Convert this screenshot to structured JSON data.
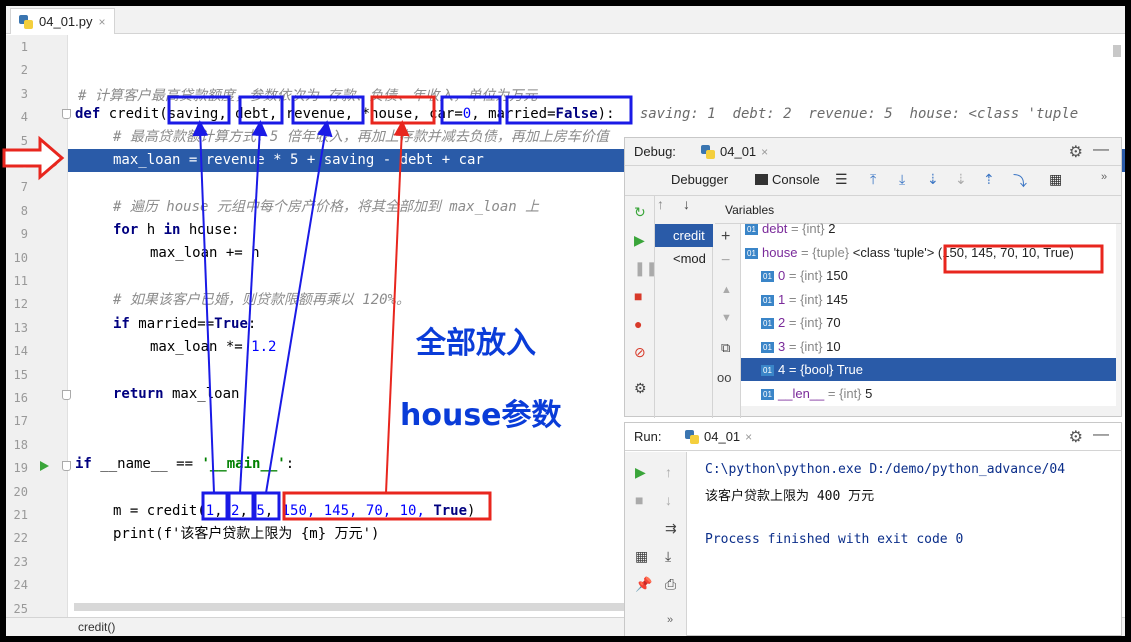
{
  "tab": {
    "filename": "04_01.py",
    "close": "×"
  },
  "gutter": {
    "lines": [
      "1",
      "2",
      "3",
      "4",
      "5",
      "6",
      "7",
      "8",
      "9",
      "10",
      "11",
      "12",
      "13",
      "14",
      "15",
      "16",
      "17",
      "18",
      "19",
      "20",
      "21",
      "22",
      "23",
      "24",
      "25"
    ]
  },
  "code": {
    "l3": "# 计算客户最高贷款额度，参数依次为 存款、负债、年收入，单位为万元",
    "l4_def": "def",
    "l4_name": " credit(",
    "l4_p1": "saving",
    "l4_p2": "debt",
    "l4_p3": "revenue",
    "l4_p4": "*house",
    "l4_p5a": "car=",
    "l4_p5b": "0",
    "l4_p6a": "married=",
    "l4_p6b": "False",
    "l4_end": "):",
    "l4_hint": "saving: 1  debt: 2  revenue: 5  house: <class 'tuple",
    "l5": "# 最高贷款额计算方式：5 倍年收入，再加上存款并减去负债，再加上房车价值",
    "l6": "max_loan = revenue * 5 + saving - debt + car",
    "l8": "# 遍历 house 元组中每个房产价格，将其全部加到 max_loan 上",
    "l9_kw1": "for",
    "l9_mid": " h ",
    "l9_kw2": "in",
    "l9_end": " house:",
    "l10": "max_loan += h",
    "l12": "# 如果该客户已婚，则贷款限额再乘以 120%。",
    "l13_kw": "if",
    "l13_mid": " married==",
    "l13_true": "True",
    "l13_end": ":",
    "l14a": "max_loan *= ",
    "l14b": "1.2",
    "l16_kw": "return",
    "l16_end": " max_loan",
    "l19_kw": "if",
    "l19_mid": " __name__ == ",
    "l19_str": "'__main__'",
    "l19_end": ":",
    "l21_a": "m = credit(",
    "l21_n1": "1",
    "l21_n2": "2",
    "l21_n3": "5",
    "l21_rest": "150, 145, 70, 10, ",
    "l21_true": "True",
    "l21_end": ")",
    "l22": "print(f'该客户贷款上限为 {m} 万元')"
  },
  "status_bar": "credit()",
  "debug": {
    "title": "Debug:",
    "tab": "04_01",
    "debugger_tab": "Debugger",
    "console_tab": "Console",
    "variables_header": "Variables",
    "frames": [
      "credit",
      "<mod"
    ],
    "vars": [
      {
        "name": "debt",
        "type": "= {int}",
        "value": "2"
      },
      {
        "name": "house",
        "type": "= {tuple}",
        "value": "<class 'tuple'> (150, 145, 70, 10, True)"
      },
      {
        "name": "0",
        "type": "= {int}",
        "value": "150"
      },
      {
        "name": "1",
        "type": "= {int}",
        "value": "145"
      },
      {
        "name": "2",
        "type": "= {int}",
        "value": "70"
      },
      {
        "name": "3",
        "type": "= {int}",
        "value": "10"
      },
      {
        "name": "4",
        "type": "= {bool}",
        "value": "True"
      },
      {
        "name": "__len__",
        "type": "= {int}",
        "value": "5"
      }
    ]
  },
  "run": {
    "title": "Run:",
    "tab": "04_01",
    "cmd": "C:\\python\\python.exe D:/demo/python_advance/04",
    "out1": "该客户贷款上限为 400 万元",
    "out2": "Process finished with exit code 0"
  },
  "annotations": {
    "line1": "全部放入",
    "line2": "house参数"
  },
  "colors": {
    "highlight": "#2a5ba8",
    "blue_box": "#1a1ae6",
    "red_box": "#e8261e"
  }
}
